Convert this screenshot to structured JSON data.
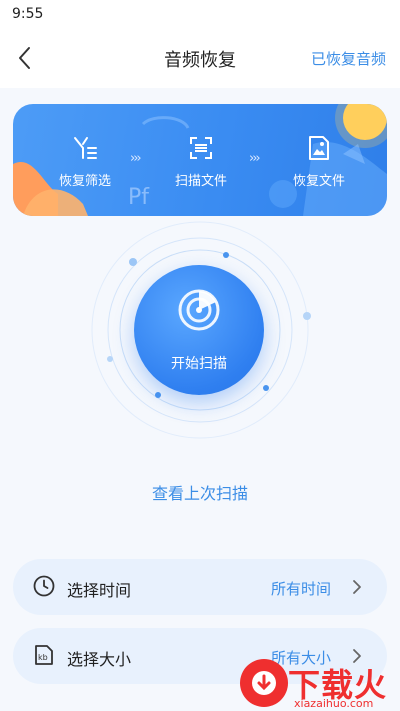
{
  "status_bar": {
    "time": "9:55"
  },
  "nav": {
    "title": "音频恢复",
    "action_label": "已恢复音频"
  },
  "banner": {
    "steps": [
      {
        "label": "恢复筛选",
        "icon": "filter-icon"
      },
      {
        "label": "扫描文件",
        "icon": "scan-frame-icon"
      },
      {
        "label": "恢复文件",
        "icon": "image-file-icon"
      }
    ]
  },
  "scan": {
    "button_label": "开始扫描",
    "icon": "radar-icon"
  },
  "last_scan_link": "查看上次扫描",
  "options": [
    {
      "label": "选择时间",
      "value": "所有时间",
      "icon": "clock-icon"
    },
    {
      "label": "选择大小",
      "value": "所有大小",
      "icon": "kb-icon"
    }
  ],
  "watermark": {
    "brand": "下载火",
    "site": "xiazaihuo.com"
  },
  "colors": {
    "accent": "#3b8de6",
    "banner": "#3a8cf2",
    "watermark": "#ef2f2f"
  }
}
